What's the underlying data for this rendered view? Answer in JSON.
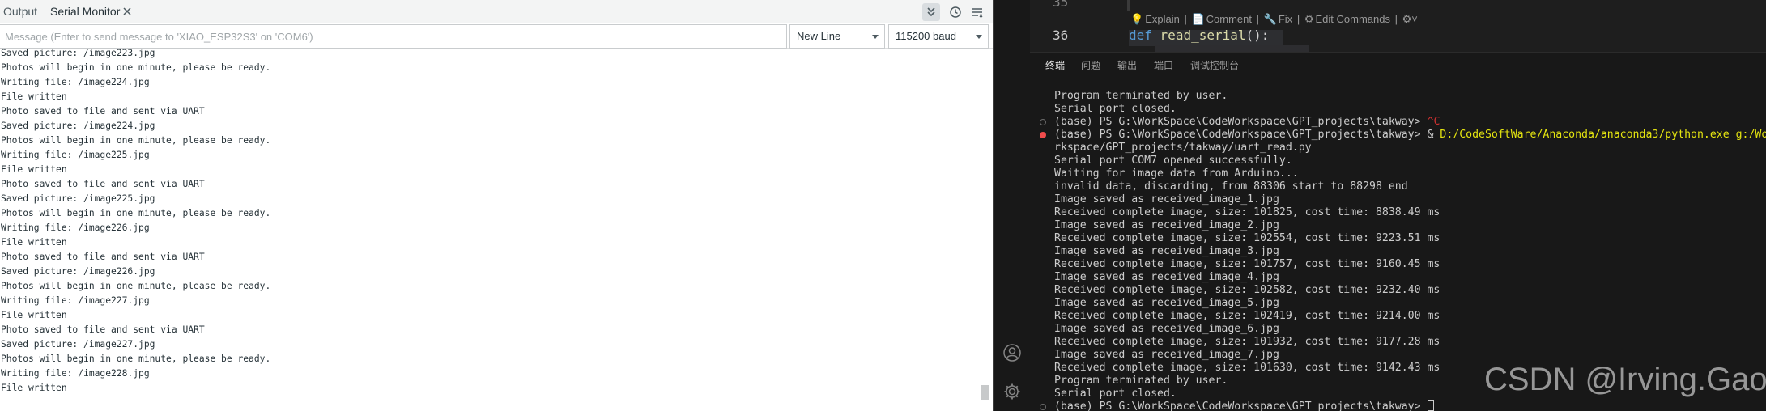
{
  "serial_monitor": {
    "tabs": {
      "output": "Output",
      "serial_monitor": "Serial Monitor"
    },
    "message_input_placeholder": "Message (Enter to send message to 'XIAO_ESP32S3' on 'COM6')",
    "line_ending": "New Line",
    "baud_rate": "115200 baud",
    "lines": [
      "Saved picture: /image223.jpg",
      "Photos will begin in one minute, please be ready.",
      "Writing file: /image224.jpg",
      "File written",
      "Photo saved to file and sent via UART",
      "Saved picture: /image224.jpg",
      "Photos will begin in one minute, please be ready.",
      "Writing file: /image225.jpg",
      "File written",
      "Photo saved to file and sent via UART",
      "Saved picture: /image225.jpg",
      "Photos will begin in one minute, please be ready.",
      "Writing file: /image226.jpg",
      "File written",
      "Photo saved to file and sent via UART",
      "Saved picture: /image226.jpg",
      "Photos will begin in one minute, please be ready.",
      "Writing file: /image227.jpg",
      "File written",
      "Photo saved to file and sent via UART",
      "Saved picture: /image227.jpg",
      "Photos will begin in one minute, please be ready.",
      "Writing file: /image228.jpg",
      "File written"
    ]
  },
  "editor": {
    "line35": "35",
    "line36": "36",
    "codelens": {
      "explain": "Explain",
      "comment": "Comment",
      "fix": "Fix",
      "edit_commands": "Edit Commands",
      "sep": "|"
    },
    "code": {
      "keyword": "def",
      "function": "read_serial",
      "punct": "():"
    }
  },
  "panel": {
    "tabs": [
      "终端",
      "问题",
      "输出",
      "端口",
      "调试控制台"
    ],
    "terminal_lines": [
      "Program terminated by user.",
      "Serial port closed.",
      "(base) PS G:\\WorkSpace\\CodeWorkspace\\GPT_projects\\takway> ",
      "(base) PS G:\\WorkSpace\\CodeWorkspace\\GPT_projects\\takway> & ",
      "rkspace/GPT_projects/takway/uart_read.py",
      "Serial port COM7 opened successfully.",
      "Waiting for image data from Arduino...",
      "invalid data, discarding, from 88306 start to 88298 end",
      "Image saved as received_image_1.jpg",
      "Received complete image, size: 101825, cost time: 8838.49 ms",
      "Image saved as received_image_2.jpg",
      "Received complete image, size: 102554, cost time: 9223.51 ms",
      "Image saved as received_image_3.jpg",
      "Received complete image, size: 101757, cost time: 9160.45 ms",
      "Image saved as received_image_4.jpg",
      "Received complete image, size: 102582, cost time: 9232.40 ms",
      "Image saved as received_image_5.jpg",
      "Received complete image, size: 102419, cost time: 9214.00 ms",
      "Image saved as received_image_6.jpg",
      "Received complete image, size: 101932, cost time: 9177.28 ms",
      "Image saved as received_image_7.jpg",
      "Received complete image, size: 101630, cost time: 9142.43 ms",
      "Program terminated by user.",
      "Serial port closed.",
      "(base) PS G:\\WorkSpace\\CodeWorkspace\\GPT_projects\\takway> "
    ],
    "ctrl_c": "^C",
    "python_command": "D:/CodeSoftWare/Anaconda/anaconda3/python.exe g:/Wo"
  },
  "watermark": "CSDN @Irving.Gao",
  "colors": {
    "accent_yellow": "#e5e510",
    "error_red": "#f14c4c",
    "terminal_bg": "#181818",
    "editor_bg": "#1e1e1e",
    "function_color": "#dcdcaa",
    "keyword_color": "#569cd6"
  }
}
